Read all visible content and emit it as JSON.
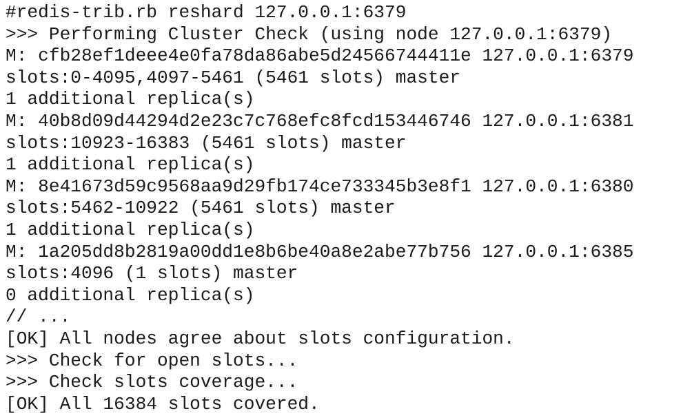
{
  "terminal": {
    "lines": [
      "#redis-trib.rb reshard 127.0.0.1:6379",
      ">>> Performing Cluster Check (using node 127.0.0.1:6379)",
      "M: cfb28ef1deee4e0fa78da86abe5d24566744411e 127.0.0.1:6379",
      "slots:0-4095,4097-5461 (5461 slots) master",
      "1 additional replica(s)",
      "M: 40b8d09d44294d2e23c7c768efc8fcd153446746 127.0.0.1:6381",
      "slots:10923-16383 (5461 slots) master",
      "1 additional replica(s)",
      "M: 8e41673d59c9568aa9d29fb174ce733345b3e8f1 127.0.0.1:6380",
      "slots:5462-10922 (5461 slots) master",
      "1 additional replica(s)",
      "M: 1a205dd8b2819a00dd1e8b6be40a8e2abe77b756 127.0.0.1:6385",
      "slots:4096 (1 slots) master",
      "0 additional replica(s)",
      "// ...",
      "[OK] All nodes agree about slots configuration.",
      ">>> Check for open slots...",
      ">>> Check slots coverage...",
      "[OK] All 16384 slots covered."
    ]
  }
}
